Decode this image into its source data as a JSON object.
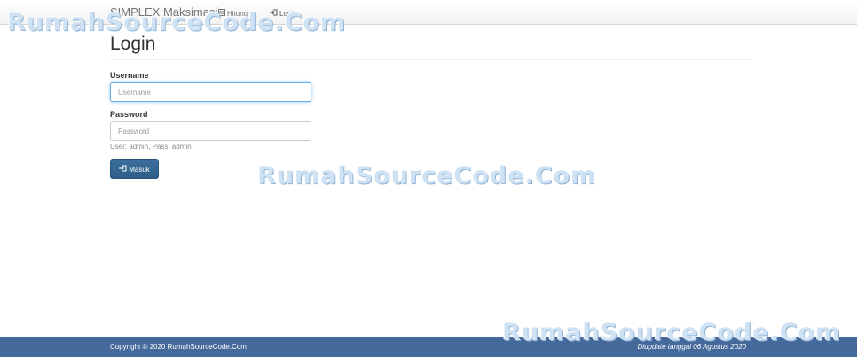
{
  "navbar": {
    "brand": "SIMPLEX Maksimasi",
    "items": [
      {
        "label": "Hitung",
        "icon": "calculator-icon"
      },
      {
        "label": "Login",
        "icon": "sign-in-icon"
      }
    ]
  },
  "page": {
    "title": "Login"
  },
  "form": {
    "username_label": "Username",
    "username_placeholder": "Username",
    "password_label": "Password",
    "password_placeholder": "Password",
    "help_text": "User: admin, Pass: admin",
    "submit_label": "Masuk",
    "submit_icon": "sign-in-icon"
  },
  "footer": {
    "copyright": "Copyright © 2020 RumahSourceCode.Com",
    "updated": "Diupdate tanggal 06 Agustus 2020"
  },
  "watermark": "RumahSourceCode.Com",
  "colors": {
    "footer_bg": "#44699a",
    "button_bg": "#2e5f8a",
    "focus_border": "#66afe9"
  }
}
